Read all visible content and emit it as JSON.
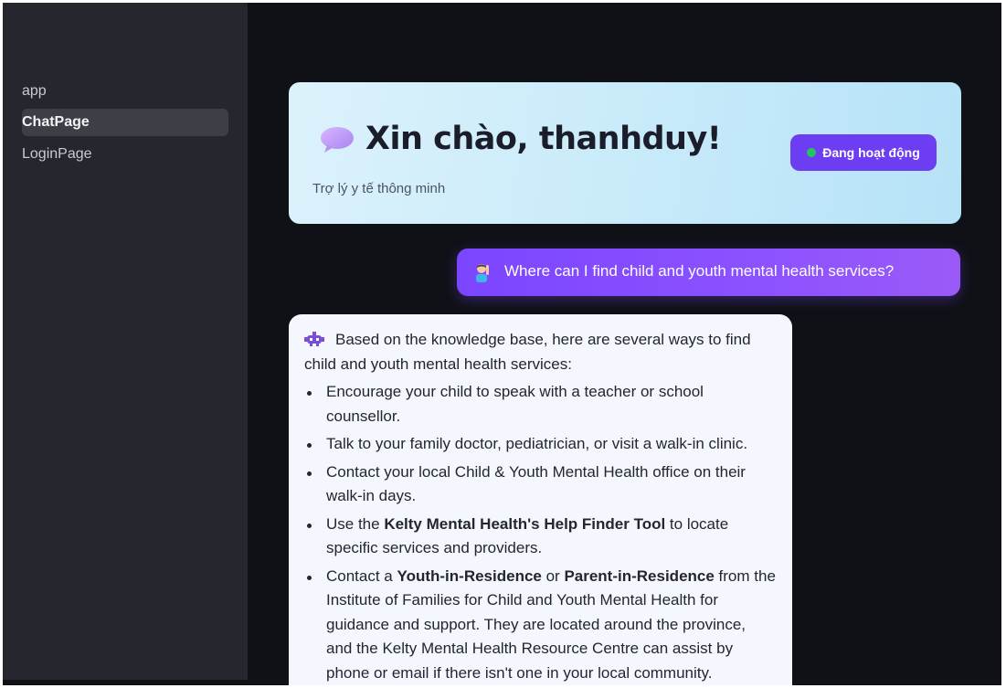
{
  "sidebar": {
    "items": [
      {
        "label": "app",
        "active": false
      },
      {
        "label": "ChatPage",
        "active": true
      },
      {
        "label": "LoginPage",
        "active": false
      }
    ]
  },
  "header": {
    "icon": "speech-bubble-icon",
    "greeting": "Xin chào, thanhduy!",
    "subtitle": "Trợ lý y tế thông minh",
    "status_label": "Đang hoạt động",
    "status_color": "#22c55e"
  },
  "chat": {
    "user_message": {
      "avatar": "person-raising-hand-icon",
      "text": "Where can I find child and youth mental health services?"
    },
    "bot_message": {
      "avatar": "robot-icon",
      "intro": "Based on the knowledge base, here are several ways to find child and youth mental health services:",
      "items": [
        {
          "before": "Encourage your child to speak with a teacher or school counsellor.",
          "bold": "",
          "after": ""
        },
        {
          "before": "Talk to your family doctor, pediatrician, or visit a walk-in clinic.",
          "bold": "",
          "after": ""
        },
        {
          "before": "Contact your local Child & Youth Mental Health office on their walk-in days.",
          "bold": "",
          "after": ""
        },
        {
          "before": "Use the ",
          "bold": "Kelty Mental Health's Help Finder Tool",
          "after": " to locate specific services and providers."
        },
        {
          "before": "Contact a ",
          "bold": "Youth-in-Residence",
          "mid": " or ",
          "bold2": "Parent-in-Residence",
          "after": " from the Institute of Families for Child and Youth Mental Health for guidance and support. They are located around the province, and the Kelty Mental Health Resource Centre can assist by phone or email if there isn't one in your local community."
        }
      ]
    }
  },
  "colors": {
    "accent": "#6d3ef1",
    "sidebar_bg": "#25262e",
    "main_bg": "#0f1116"
  }
}
